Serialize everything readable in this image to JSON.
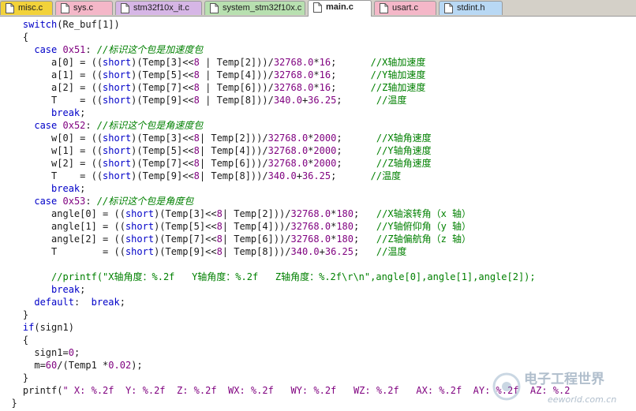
{
  "tabs": [
    {
      "label": "misc.c",
      "color": "#f2d23a",
      "active": false
    },
    {
      "label": "sys.c",
      "color": "#f4b7c8",
      "active": false
    },
    {
      "label": "stm32f10x_it.c",
      "color": "#d6b6e6",
      "active": false
    },
    {
      "label": "system_stm32f10x.c",
      "color": "#b8e0b0",
      "active": false
    },
    {
      "label": "main.c",
      "color": "#f2d23a",
      "active": true
    },
    {
      "label": "usart.c",
      "color": "#f4b7c8",
      "active": false
    },
    {
      "label": "stdint.h",
      "color": "#b8d8f4",
      "active": false
    }
  ],
  "code_lines": [
    [
      {
        "t": "    "
      },
      {
        "t": "switch",
        "c": "k"
      },
      {
        "t": "(Re_buf[1])"
      }
    ],
    [
      {
        "t": "    {"
      }
    ],
    [
      {
        "t": "      "
      },
      {
        "t": "case",
        "c": "k"
      },
      {
        "t": " "
      },
      {
        "t": "0x51",
        "c": "n"
      },
      {
        "t": ": "
      },
      {
        "t": "//标识这个包是加速度包",
        "c": "c"
      }
    ],
    [
      {
        "t": "         a[0] = (("
      },
      {
        "t": "short",
        "c": "k"
      },
      {
        "t": ")(Temp[3]<<"
      },
      {
        "t": "8",
        "c": "n"
      },
      {
        "t": " | Temp[2]))/"
      },
      {
        "t": "32768.0",
        "c": "n"
      },
      {
        "t": "*"
      },
      {
        "t": "16",
        "c": "n"
      },
      {
        "t": ";      "
      },
      {
        "t": "//X轴加速度",
        "c": "cn"
      }
    ],
    [
      {
        "t": "         a[1] = (("
      },
      {
        "t": "short",
        "c": "k"
      },
      {
        "t": ")(Temp[5]<<"
      },
      {
        "t": "8",
        "c": "n"
      },
      {
        "t": " | Temp[4]))/"
      },
      {
        "t": "32768.0",
        "c": "n"
      },
      {
        "t": "*"
      },
      {
        "t": "16",
        "c": "n"
      },
      {
        "t": ";      "
      },
      {
        "t": "//Y轴加速度",
        "c": "cn"
      }
    ],
    [
      {
        "t": "         a[2] = (("
      },
      {
        "t": "short",
        "c": "k"
      },
      {
        "t": ")(Temp[7]<<"
      },
      {
        "t": "8",
        "c": "n"
      },
      {
        "t": " | Temp[6]))/"
      },
      {
        "t": "32768.0",
        "c": "n"
      },
      {
        "t": "*"
      },
      {
        "t": "16",
        "c": "n"
      },
      {
        "t": ";      "
      },
      {
        "t": "//Z轴加速度",
        "c": "cn"
      }
    ],
    [
      {
        "t": "         T    = (("
      },
      {
        "t": "short",
        "c": "k"
      },
      {
        "t": ")(Temp[9]<<"
      },
      {
        "t": "8",
        "c": "n"
      },
      {
        "t": " | Temp[8]))/"
      },
      {
        "t": "340.0",
        "c": "n"
      },
      {
        "t": "+"
      },
      {
        "t": "36.25",
        "c": "n"
      },
      {
        "t": ";      "
      },
      {
        "t": "//温度",
        "c": "cn"
      }
    ],
    [
      {
        "t": "         "
      },
      {
        "t": "break",
        "c": "k"
      },
      {
        "t": ";"
      }
    ],
    [
      {
        "t": "      "
      },
      {
        "t": "case",
        "c": "k"
      },
      {
        "t": " "
      },
      {
        "t": "0x52",
        "c": "n"
      },
      {
        "t": ": "
      },
      {
        "t": "//标识这个包是角速度包",
        "c": "c"
      }
    ],
    [
      {
        "t": "         w[0] = (("
      },
      {
        "t": "short",
        "c": "k"
      },
      {
        "t": ")(Temp[3]<<"
      },
      {
        "t": "8",
        "c": "n"
      },
      {
        "t": "| Temp[2]))/"
      },
      {
        "t": "32768.0",
        "c": "n"
      },
      {
        "t": "*"
      },
      {
        "t": "2000",
        "c": "n"
      },
      {
        "t": ";      "
      },
      {
        "t": "//X轴角速度",
        "c": "cn"
      }
    ],
    [
      {
        "t": "         w[1] = (("
      },
      {
        "t": "short",
        "c": "k"
      },
      {
        "t": ")(Temp[5]<<"
      },
      {
        "t": "8",
        "c": "n"
      },
      {
        "t": "| Temp[4]))/"
      },
      {
        "t": "32768.0",
        "c": "n"
      },
      {
        "t": "*"
      },
      {
        "t": "2000",
        "c": "n"
      },
      {
        "t": ";      "
      },
      {
        "t": "//Y轴角速度",
        "c": "cn"
      }
    ],
    [
      {
        "t": "         w[2] = (("
      },
      {
        "t": "short",
        "c": "k"
      },
      {
        "t": ")(Temp[7]<<"
      },
      {
        "t": "8",
        "c": "n"
      },
      {
        "t": "| Temp[6]))/"
      },
      {
        "t": "32768.0",
        "c": "n"
      },
      {
        "t": "*"
      },
      {
        "t": "2000",
        "c": "n"
      },
      {
        "t": ";      "
      },
      {
        "t": "//Z轴角速度",
        "c": "cn"
      }
    ],
    [
      {
        "t": "         T    = (("
      },
      {
        "t": "short",
        "c": "k"
      },
      {
        "t": ")(Temp[9]<<"
      },
      {
        "t": "8",
        "c": "n"
      },
      {
        "t": "| Temp[8]))/"
      },
      {
        "t": "340.0",
        "c": "n"
      },
      {
        "t": "+"
      },
      {
        "t": "36.25",
        "c": "n"
      },
      {
        "t": ";      "
      },
      {
        "t": "//温度",
        "c": "cn"
      }
    ],
    [
      {
        "t": "         "
      },
      {
        "t": "break",
        "c": "k"
      },
      {
        "t": ";"
      }
    ],
    [
      {
        "t": "      "
      },
      {
        "t": "case",
        "c": "k"
      },
      {
        "t": " "
      },
      {
        "t": "0x53",
        "c": "n"
      },
      {
        "t": ": "
      },
      {
        "t": "//标识这个包是角度包",
        "c": "c"
      }
    ],
    [
      {
        "t": "         angle[0] = (("
      },
      {
        "t": "short",
        "c": "k"
      },
      {
        "t": ")(Temp[3]<<"
      },
      {
        "t": "8",
        "c": "n"
      },
      {
        "t": "| Temp[2]))/"
      },
      {
        "t": "32768.0",
        "c": "n"
      },
      {
        "t": "*"
      },
      {
        "t": "180",
        "c": "n"
      },
      {
        "t": ";   "
      },
      {
        "t": "//X轴滚转角（x 轴）",
        "c": "cn"
      }
    ],
    [
      {
        "t": "         angle[1] = (("
      },
      {
        "t": "short",
        "c": "k"
      },
      {
        "t": ")(Temp[5]<<"
      },
      {
        "t": "8",
        "c": "n"
      },
      {
        "t": "| Temp[4]))/"
      },
      {
        "t": "32768.0",
        "c": "n"
      },
      {
        "t": "*"
      },
      {
        "t": "180",
        "c": "n"
      },
      {
        "t": ";   "
      },
      {
        "t": "//Y轴俯仰角（y 轴）",
        "c": "cn"
      }
    ],
    [
      {
        "t": "         angle[2] = (("
      },
      {
        "t": "short",
        "c": "k"
      },
      {
        "t": ")(Temp[7]<<"
      },
      {
        "t": "8",
        "c": "n"
      },
      {
        "t": "| Temp[6]))/"
      },
      {
        "t": "32768.0",
        "c": "n"
      },
      {
        "t": "*"
      },
      {
        "t": "180",
        "c": "n"
      },
      {
        "t": ";   "
      },
      {
        "t": "//Z轴偏航角（z 轴）",
        "c": "cn"
      }
    ],
    [
      {
        "t": "         T        = (("
      },
      {
        "t": "short",
        "c": "k"
      },
      {
        "t": ")(Temp[9]<<"
      },
      {
        "t": "8",
        "c": "n"
      },
      {
        "t": "| Temp[8]))/"
      },
      {
        "t": "340.0",
        "c": "n"
      },
      {
        "t": "+"
      },
      {
        "t": "36.25",
        "c": "n"
      },
      {
        "t": ";   "
      },
      {
        "t": "//温度",
        "c": "cn"
      }
    ],
    [
      {
        "t": ""
      }
    ],
    [
      {
        "t": "         "
      },
      {
        "t": "//printf(\"X轴角度：%.2f   Y轴角度：%.2f   Z轴角度：%.2f\\r\\n\",angle[0],angle[1],angle[2]);",
        "c": "cn"
      }
    ],
    [
      {
        "t": "         "
      },
      {
        "t": "break",
        "c": "k"
      },
      {
        "t": ";"
      }
    ],
    [
      {
        "t": "      "
      },
      {
        "t": "default",
        "c": "k"
      },
      {
        "t": ":  "
      },
      {
        "t": "break",
        "c": "k"
      },
      {
        "t": ";"
      }
    ],
    [
      {
        "t": "    }"
      }
    ],
    [
      {
        "t": "    "
      },
      {
        "t": "if",
        "c": "k"
      },
      {
        "t": "(sign1)"
      }
    ],
    [
      {
        "t": "    {"
      }
    ],
    [
      {
        "t": "      sign1="
      },
      {
        "t": "0",
        "c": "n"
      },
      {
        "t": ";"
      }
    ],
    [
      {
        "t": "      m="
      },
      {
        "t": "60",
        "c": "n"
      },
      {
        "t": "/(Temp1 *"
      },
      {
        "t": "0.02",
        "c": "n"
      },
      {
        "t": ");"
      }
    ],
    [
      {
        "t": "    }"
      }
    ],
    [
      {
        "t": "    printf("
      },
      {
        "t": "\" X: %.2f  Y: %.2f  Z: %.2f  WX: %.2f   WY: %.2f   WZ: %.2f   AX: %.2f  AY: %.2f  AZ: %.2",
        "c": "s"
      }
    ],
    [
      {
        "t": "  }"
      }
    ]
  ],
  "watermark": {
    "line1": "电子工程世界",
    "line2": "eeworld.com.cn"
  }
}
